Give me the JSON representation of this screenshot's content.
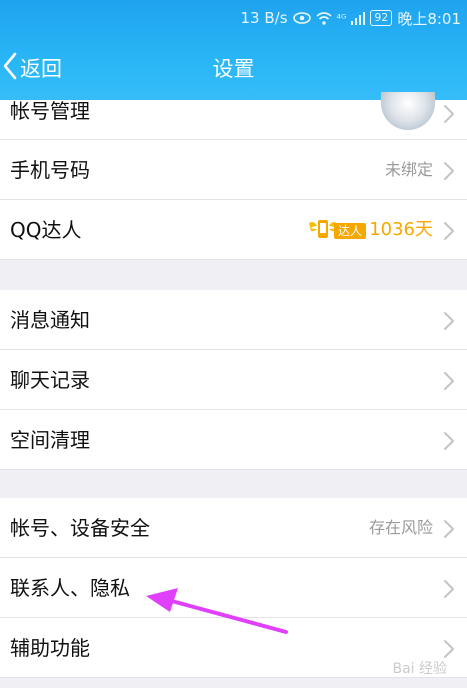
{
  "status_bar": {
    "speed": "13 B/s",
    "signal": "⁴ᴳ",
    "battery": "92",
    "time": "晚上8:01"
  },
  "nav": {
    "back_label": "返回",
    "title": "设置"
  },
  "settings": {
    "account": {
      "label": "帐号管理"
    },
    "phone": {
      "label": "手机号码",
      "value": "未绑定"
    },
    "qq_expert": {
      "label": "QQ达人",
      "badge": "达人",
      "days": "1036天"
    },
    "notifications": {
      "label": "消息通知"
    },
    "chat_history": {
      "label": "聊天记录"
    },
    "space_cleanup": {
      "label": "空间清理"
    },
    "security": {
      "label": "帐号、设备安全",
      "value": "存在风险"
    },
    "privacy": {
      "label": "联系人、隐私"
    },
    "accessibility": {
      "label": "辅助功能"
    }
  },
  "watermark": "Bai 经验",
  "colors": {
    "header": "#29b6f6",
    "badge": "#f6a800",
    "annotation": "#e040fb"
  }
}
